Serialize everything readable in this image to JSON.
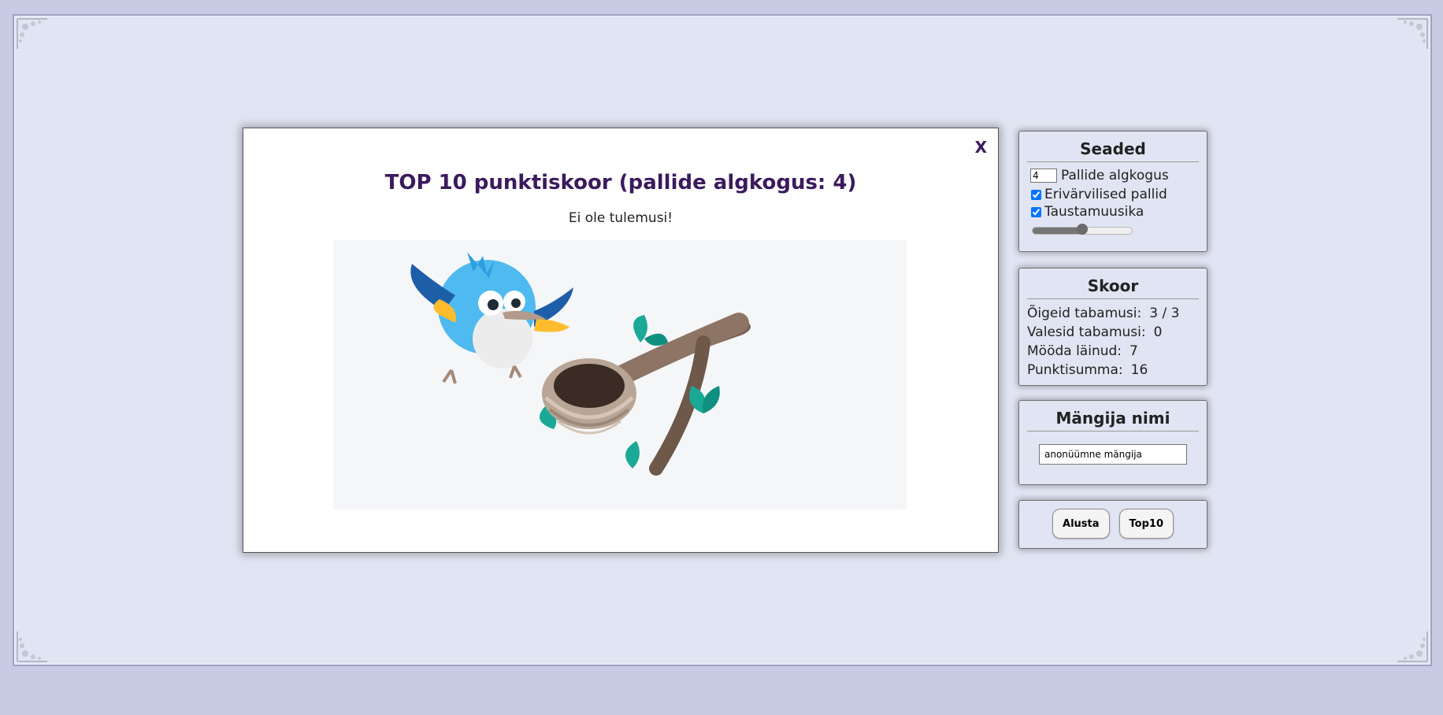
{
  "modal": {
    "close_label": "X",
    "title": "TOP 10 punktiskoor (pallide algkogus: 4)",
    "message": "Ei ole tulemusi!"
  },
  "settings": {
    "title": "Seaded",
    "ball_count_value": "4",
    "ball_count_label": "Pallide algkogus",
    "colored_balls_label": "Erivärvilised pallid",
    "colored_balls_checked": true,
    "music_label": "Taustamuusika",
    "music_checked": true,
    "volume_fraction": 0.5
  },
  "score": {
    "title": "Skoor",
    "rows": [
      {
        "label": "Õigeid tabamusi:",
        "value": "3 / 3"
      },
      {
        "label": "Valesid tabamusi:",
        "value": "0"
      },
      {
        "label": "Mööda läinud:",
        "value": "7"
      },
      {
        "label": "Punktisumma:",
        "value": "16"
      }
    ]
  },
  "player": {
    "title": "Mängija nimi",
    "name_value": "anonüümne mängija"
  },
  "actions": {
    "start_label": "Alusta",
    "top10_label": "Top10"
  },
  "colors": {
    "accent": "#3b1a5e",
    "page_bg": "#c7cbe3",
    "panel_bg": "#e1e4f2"
  }
}
